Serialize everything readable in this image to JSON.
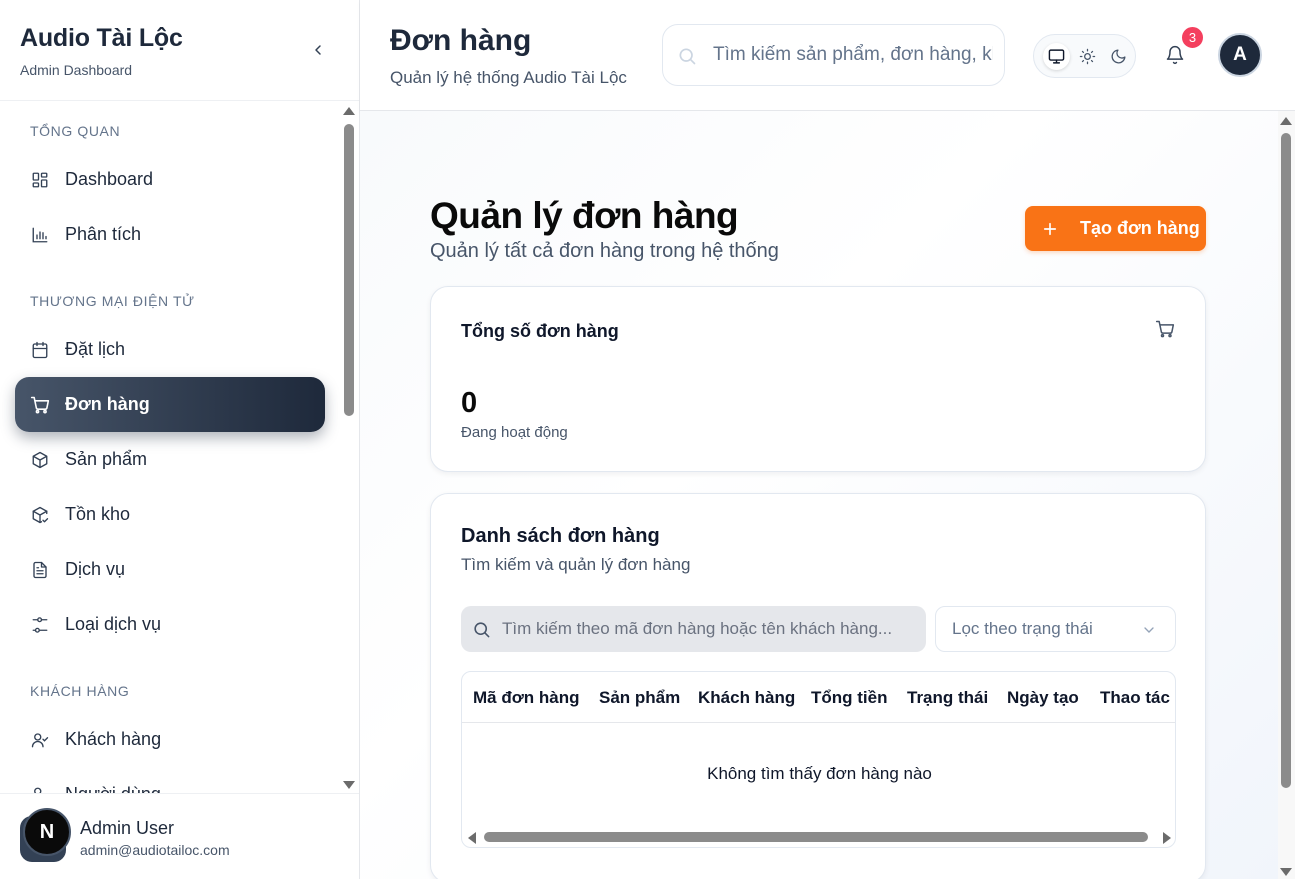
{
  "sidebar": {
    "brand_title": "Audio Tài Lộc",
    "brand_subtitle": "Admin Dashboard",
    "sections": [
      {
        "label": "TỔNG QUAN"
      },
      {
        "label": "THƯƠNG MẠI ĐIỆN TỬ"
      },
      {
        "label": "KHÁCH HÀNG"
      }
    ],
    "items": [
      {
        "label": "Dashboard",
        "icon": "grid-icon"
      },
      {
        "label": "Phân tích",
        "icon": "bar-chart-icon"
      },
      {
        "label": "Đặt lịch",
        "icon": "calendar-icon"
      },
      {
        "label": "Đơn hàng",
        "icon": "cart-icon",
        "active": true
      },
      {
        "label": "Sản phẩm",
        "icon": "package-icon"
      },
      {
        "label": "Tồn kho",
        "icon": "package-check-icon"
      },
      {
        "label": "Dịch vụ",
        "icon": "file-text-icon"
      },
      {
        "label": "Loại dịch vụ",
        "icon": "sliders-icon"
      },
      {
        "label": "Khách hàng",
        "icon": "user-check-icon"
      },
      {
        "label": "Người dùng",
        "icon": "users-icon"
      }
    ],
    "user": {
      "initial": "N",
      "name": "Admin User",
      "email": "admin@audiotailoc.com"
    }
  },
  "header": {
    "title": "Đơn hàng",
    "subtitle": "Quản lý hệ thống Audio Tài Lộc",
    "search_placeholder": "Tìm kiếm sản phẩm, đơn hàng, khách hàng...",
    "notification_count": "3",
    "avatar_initial": "A"
  },
  "main": {
    "heading": "Quản lý đơn hàng",
    "subheading": "Quản lý tất cả đơn hàng trong hệ thống",
    "create_button": "Tạo đơn hàng",
    "stat_card": {
      "title": "Tổng số đơn hàng",
      "value": "0",
      "caption": "Đang hoạt động"
    },
    "list_card": {
      "title": "Danh sách đơn hàng",
      "subtitle": "Tìm kiếm và quản lý đơn hàng",
      "search_placeholder": "Tìm kiếm theo mã đơn hàng hoặc tên khách hàng...",
      "filter_label": "Lọc theo trạng thái",
      "columns": [
        "Mã đơn hàng",
        "Sản phẩm",
        "Khách hàng",
        "Tổng tiền",
        "Trạng thái",
        "Ngày tạo",
        "Thao tác"
      ],
      "empty_text": "Không tìm thấy đơn hàng nào"
    }
  },
  "colors": {
    "accent": "#f97316",
    "active_nav_start": "#475569",
    "active_nav_end": "#1e293b",
    "badge": "#f43f5e"
  }
}
